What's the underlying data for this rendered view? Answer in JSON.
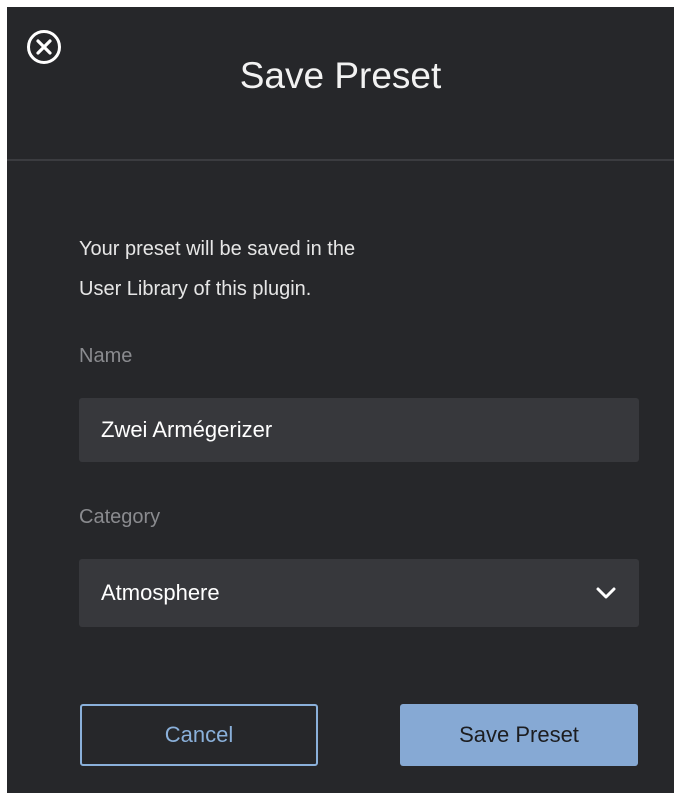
{
  "dialog": {
    "title": "Save Preset",
    "close_icon": "close-circle-icon",
    "description_line1": "Your preset will be saved in the",
    "description_line2": "User Library of this plugin.",
    "name_label": "Name",
    "name_value": "Zwei Armégerizer",
    "category_label": "Category",
    "category_value": "Atmosphere",
    "dropdown_icon": "chevron-down-icon",
    "cancel_label": "Cancel",
    "save_label": "Save Preset"
  },
  "colors": {
    "background": "#26272a",
    "input_background": "#37383c",
    "accent": "#86a9d4",
    "muted_text": "#8a8b8f"
  }
}
